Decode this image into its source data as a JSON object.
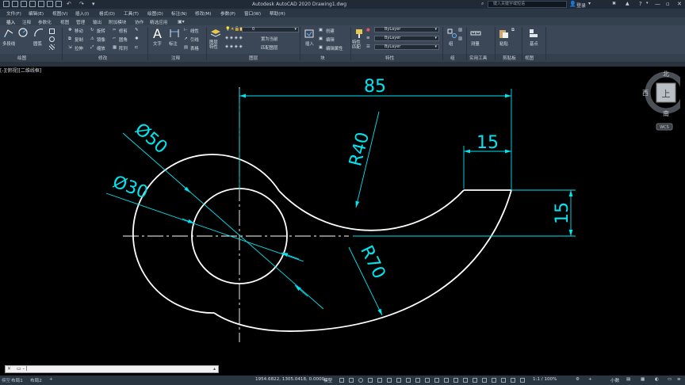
{
  "window": {
    "title": "Autodesk AutoCAD 2020    Drawing1.dwg",
    "search_placeholder": "键入关键字或短语",
    "login": "登录",
    "minimize": "—",
    "restore": "▫",
    "close": "✕"
  },
  "menu": [
    "文件(F)",
    "编辑(E)",
    "视图(V)",
    "插入(I)",
    "格式(O)",
    "工具(T)",
    "绘图(D)",
    "标注(N)",
    "修改(M)",
    "参数(P)",
    "窗口(W)",
    "帮助(H)"
  ],
  "ribbon_tabs": [
    "插入",
    "注释",
    "参数化",
    "视图",
    "管理",
    "输出",
    "附加模块",
    "协作",
    "精选应用"
  ],
  "ribbon": {
    "draw": {
      "polyline": "多段线",
      "arc": "圆弧",
      "label": "绘图"
    },
    "modify": {
      "move": "移动",
      "rotate": "旋转",
      "trim": "修剪",
      "copy": "复制",
      "mirror": "镜像",
      "fillet": "圆角",
      "stretch": "拉伸",
      "scale": "缩放",
      "array": "阵列",
      "label": "修改"
    },
    "annotation": {
      "text": "文字",
      "dimension": "标注",
      "linear": "线性",
      "leader": "引线",
      "table": "表格",
      "label": "注释"
    },
    "layers": {
      "layer_props": "图层特性",
      "layer_current": "0",
      "make_current": "置为当前",
      "match_layer": "匹配图层",
      "label": "图层"
    },
    "block": {
      "insert": "插入",
      "create": "创建",
      "edit": "编辑",
      "edit_attr": "编辑属性",
      "label": "块"
    },
    "properties": {
      "match": "特性匹配",
      "color": "ByLayer",
      "linetype": "ByLayer",
      "lineweight": "ByLayer",
      "label": "特性"
    },
    "groups": {
      "group": "组",
      "label": "组"
    },
    "utilities": {
      "measure": "测量",
      "label": "实用工具"
    },
    "clipboard": {
      "paste": "粘贴",
      "label": "剪贴板"
    },
    "view": {
      "base": "基点",
      "label": "视图"
    }
  },
  "viewport": {
    "label": "[-][俯视][二维线框]"
  },
  "viewcube": {
    "north": "北",
    "south": "南",
    "west": "西",
    "face": "上",
    "wcs": "WCS"
  },
  "drawing": {
    "dims": {
      "width_85": "85",
      "width_15": "15",
      "height_15": "15",
      "r40": "R40",
      "r70": "R70",
      "d50": "Ø50",
      "d30": "Ø30"
    }
  },
  "command": {
    "prompt": "▭ - |"
  },
  "status": {
    "model_tab": "模型",
    "layout1": "布局1",
    "layout2": "布局2",
    "coords": "1954.6822, 1305.0418, 0.0000",
    "model": "模型",
    "scale": "1:1 / 100%",
    "units": "小数"
  },
  "colors": {
    "dim": "#00e5f0",
    "geometry": "#ffffff",
    "centerline": "#ffffff",
    "background": "#000000"
  }
}
